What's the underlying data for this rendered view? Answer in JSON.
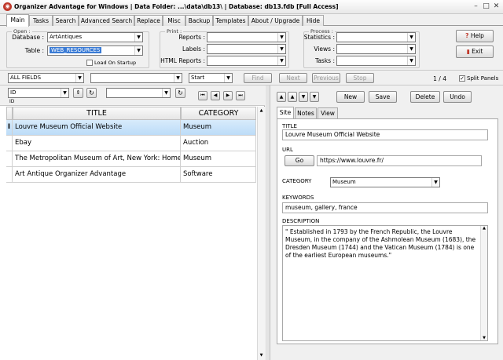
{
  "window": {
    "title": "Organizer Advantage for Windows | Data Folder: ...\\data\\db13\\ | Database: db13.fdb [Full Access]"
  },
  "tabs": [
    {
      "label": "Main"
    },
    {
      "label": "Tasks"
    },
    {
      "label": "Search"
    },
    {
      "label": "Advanced Search"
    },
    {
      "label": "Replace"
    },
    {
      "label": "Misc"
    },
    {
      "label": "Backup"
    },
    {
      "label": "Templates"
    },
    {
      "label": "About / Upgrade"
    },
    {
      "label": "Hide"
    }
  ],
  "open": {
    "group": "Open :",
    "database_label": "Database :",
    "database_value": "ArtAntiques",
    "table_label": "Table :",
    "table_value": "WEB_RESOURCES",
    "load_on_startup": "Load On Startup"
  },
  "print": {
    "group": "Print :",
    "reports_label": "Reports :",
    "labels_label": "Labels :",
    "html_label": "HTML Reports :"
  },
  "process": {
    "group": "Process :",
    "statistics_label": "Statistics :",
    "views_label": "Views :",
    "tasks_label": "Tasks :"
  },
  "help_label": "Help",
  "exit_label": "Exit",
  "search": {
    "field": "ALL FIELDS",
    "mode": "Start",
    "find": "Find",
    "next": "Next",
    "previous": "Previous",
    "stop": "Stop",
    "record_count": "1 / 4",
    "split_panels": "Split Panels"
  },
  "sort": {
    "field": "ID",
    "sub": "ID"
  },
  "grid": {
    "headers": [
      "TITLE",
      "CATEGORY"
    ],
    "rows": [
      [
        "Louvre Museum Official Website",
        "Museum"
      ],
      [
        "Ebay",
        "Auction"
      ],
      [
        "The Metropolitan Museum of Art, New York: Home",
        "Museum"
      ],
      [
        "Art Antique Organizer Advantage",
        "Software"
      ]
    ]
  },
  "record_buttons": {
    "new": "New",
    "save": "Save",
    "delete": "Delete",
    "undo": "Undo"
  },
  "subtabs": [
    {
      "label": "Site"
    },
    {
      "label": "Notes"
    },
    {
      "label": "View"
    }
  ],
  "record": {
    "title_label": "TITLE",
    "title": "Louvre Museum Official Website",
    "url_label": "URL",
    "go": "Go",
    "url": "https://www.louvre.fr/",
    "category_label": "CATEGORY",
    "category": "Museum",
    "keywords_label": "KEYWORDS",
    "keywords": "museum, gallery, france",
    "description_label": "DESCRIPTION",
    "description": "\" Established in 1793 by the French Republic, the Louvre Museum, in the company of the Ashmolean Museum (1683), the Dresden Museum (1744) and the Vatican Museum (1784) is one of the earliest European museums.\""
  }
}
